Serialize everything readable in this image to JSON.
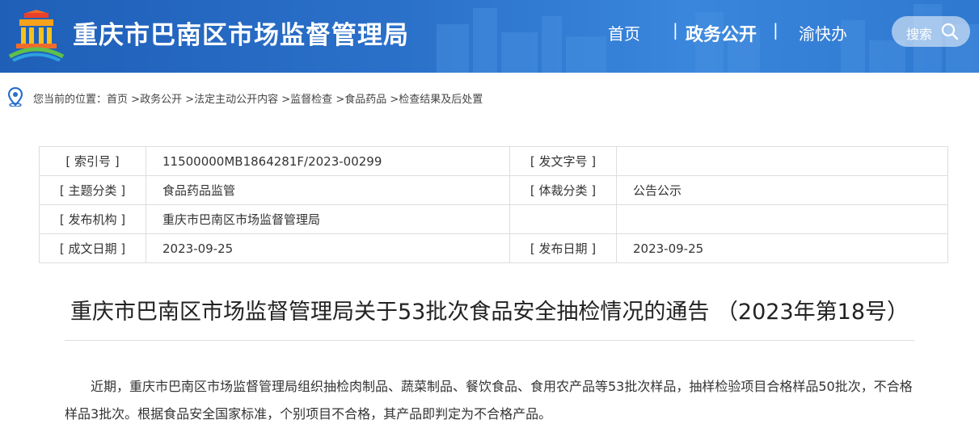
{
  "header": {
    "site_title": "重庆市巴南区市场监督管理局",
    "nav": {
      "home": "首页",
      "separator": "|",
      "gov_open": "政务公开",
      "yukuaiban": "渝快办"
    },
    "search_label": "搜索",
    "icons": [
      "logo-emblem",
      "search-icon"
    ],
    "colors": {
      "header_bg": "#2a70c9",
      "text": "#ffffff"
    }
  },
  "breadcrumb": {
    "prefix": "您当前的位置：",
    "items": [
      "首页",
      ">政务公开",
      ">法定主动公开内容",
      ">监督检查",
      ">食品药品",
      ">检查结果及后处置"
    ],
    "icon": "location-pin-icon"
  },
  "meta": {
    "rows": [
      {
        "l1": "[ 索引号 ]",
        "v1": "11500000MB1864281F/2023-00299",
        "l2": "[ 发文字号 ]",
        "v2": ""
      },
      {
        "l1": "[ 主题分类 ]",
        "v1": "食品药品监管",
        "l2": "[ 体裁分类 ]",
        "v2": "公告公示"
      },
      {
        "l1": "[ 发布机构 ]",
        "v1": "重庆市巴南区市场监督管理局",
        "l2": "",
        "v2": ""
      },
      {
        "l1": "[ 成文日期 ]",
        "v1": "2023-09-25",
        "l2": "[ 发布日期 ]",
        "v2": "2023-09-25"
      }
    ]
  },
  "article": {
    "title": "重庆市巴南区市场监督管理局关于53批次食品安全抽检情况的通告 （2023年第18号）",
    "paragraph": "近期，重庆市巴南区市场监督管理局组织抽检肉制品、蔬菜制品、餐饮食品、食用农产品等53批次样品，抽样检验项目合格样品50批次，不合格样品3批次。根据食品安全国家标准，个别项目不合格，其产品即判定为不合格产品。"
  }
}
